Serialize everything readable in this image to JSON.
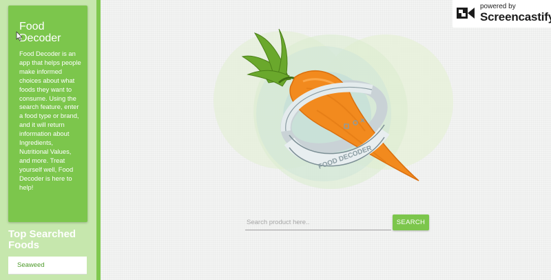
{
  "sidebar": {
    "about": {
      "title": "Food Decoder",
      "description": "Food Decoder is an app that helps people make informed choices about what foods they want to consume. Using the search feature, enter a food type or brand, and it will return information about Ingredients, Nutritional Values, and more. Treat yourself well, Food Decoder is here to help!"
    },
    "top_searched": {
      "title": "Top Searched Foods",
      "items": [
        {
          "label": "Seaweed"
        }
      ]
    }
  },
  "watermark": {
    "powered_by": "powered by",
    "brand": "Screencastify"
  },
  "hero": {
    "icon": "carrot-ring-logo",
    "ring_text": "FOOD DECODER"
  },
  "search": {
    "placeholder": "Search product here..",
    "value": "",
    "button_label": "SEARCH"
  },
  "colors": {
    "accent_green": "#7cc64c",
    "sidebar_bg": "#c6e7ad",
    "carrot_orange": "#f28a1e",
    "leaf_green": "#5f9e24"
  }
}
